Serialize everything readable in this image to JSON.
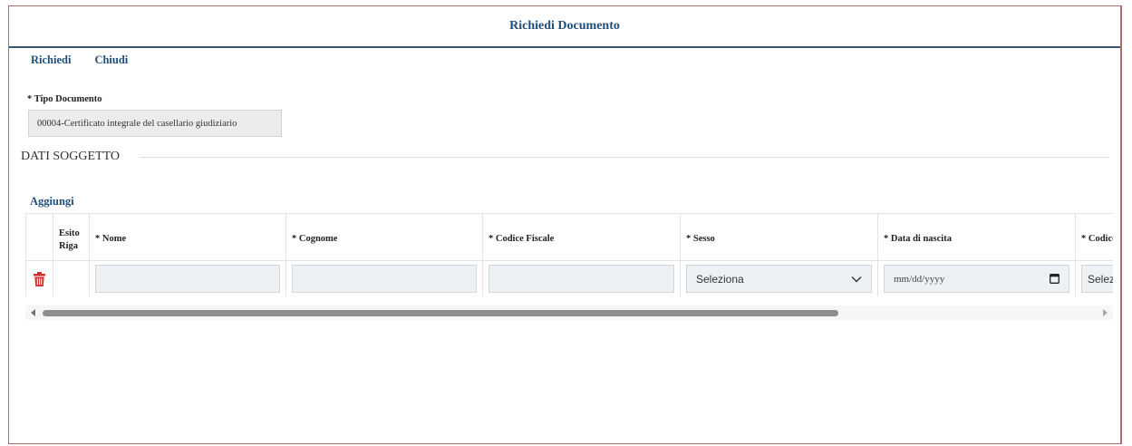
{
  "window": {
    "title": "Richiedi Documento"
  },
  "toolbar": {
    "richiedi": "Richiedi",
    "chiudi": "Chiudi"
  },
  "tipo_documento": {
    "label": "* Tipo Documento",
    "value": "00004-Certificato integrale del casellario giudiziario"
  },
  "section": {
    "title": "DATI SOGGETTO"
  },
  "subjects": {
    "add_label": "Aggiungi",
    "columns": {
      "esito_line1": "Esito",
      "esito_line2": "Riga",
      "nome": "* Nome",
      "cognome": "* Cognome",
      "codice_fiscale": "* Codice Fiscale",
      "sesso": "* Sesso",
      "data_nascita": "* Data di nascita",
      "codice": "* Codice"
    },
    "rows": [
      {
        "nome": "",
        "cognome": "",
        "codice_fiscale": "",
        "sesso": "Seleziona",
        "data_nascita": "mm/dd/yyyy",
        "codice": "Selezi"
      }
    ]
  },
  "colors": {
    "accent": "#1f4e79",
    "delete": "#d32f2f",
    "frame": "#b26b6b"
  },
  "icons": [
    "trash-icon",
    "chevron-down-icon",
    "calendar-icon",
    "scroll-left-icon",
    "scroll-right-icon"
  ]
}
